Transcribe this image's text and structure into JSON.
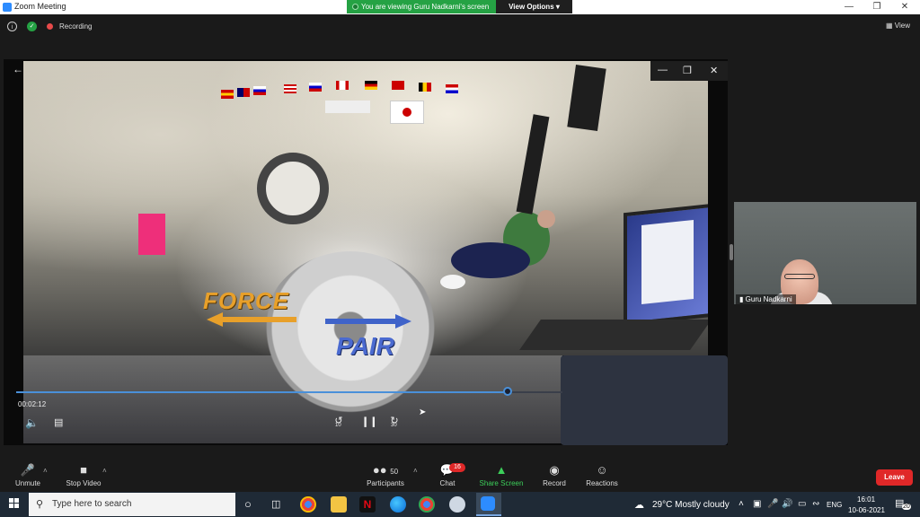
{
  "window": {
    "title": "Zoom Meeting",
    "minimize_icon": "minimize-icon",
    "maximize_icon": "restore-icon",
    "close_icon": "close-icon"
  },
  "banner": {
    "viewing_text": "You are viewing Guru Nadkarni's screen",
    "view_options": "View Options"
  },
  "infobar": {
    "recording_label": "Recording",
    "view_label": "View"
  },
  "player": {
    "time": "00:02:12",
    "progress": 0.9,
    "rewind_label": "10",
    "forward_label": "30"
  },
  "overlay": {
    "force_text": "FORCE",
    "pair_text": "PAIR"
  },
  "speaker": {
    "name": "Guru Nadkarni"
  },
  "toolbar": {
    "unmute": "Unmute",
    "stop_video": "Stop Video",
    "participants": "Participants",
    "participants_count": "50",
    "chat": "Chat",
    "chat_badge": "16",
    "share_screen": "Share Screen",
    "record": "Record",
    "reactions": "Reactions",
    "leave": "Leave"
  },
  "taskbar": {
    "search_placeholder": "Type here to search",
    "weather": "29°C  Mostly cloudy",
    "language": "ENG",
    "time": "16:01",
    "date": "10-06-2021",
    "notifications": "20"
  },
  "colors": {
    "accent": "#2d8cff",
    "share_green": "#25a244",
    "leave_red": "#e02828",
    "progress_blue": "#4a90d9"
  }
}
